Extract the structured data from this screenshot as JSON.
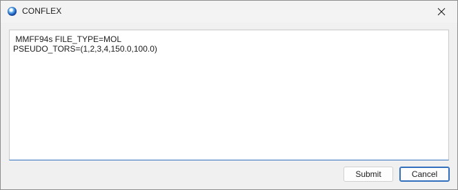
{
  "window": {
    "title": "CONFLEX",
    "app_icon": "conflex-app-icon",
    "close_icon": "close-icon"
  },
  "editor": {
    "line1": " MMFF94s FILE_TYPE=MOL",
    "line2": "PSEUDO_TORS=(1,2,3,4,150.0,100.0)"
  },
  "buttons": {
    "submit_label": "Submit",
    "cancel_label": "Cancel"
  },
  "colors": {
    "accent": "#2f6ebd",
    "background": "#f0f0f0"
  }
}
